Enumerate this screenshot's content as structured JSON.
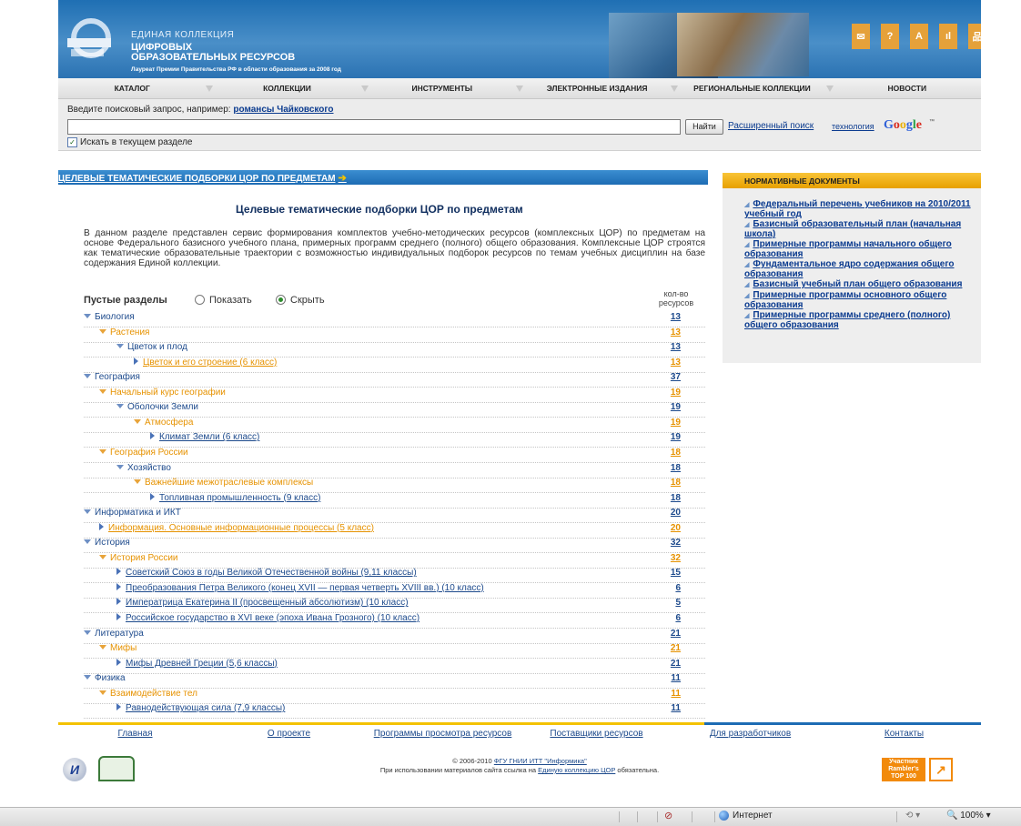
{
  "header": {
    "logo_line1": "ЕДИНАЯ КОЛЛЕКЦИЯ",
    "logo_line2": "ЦИФРОВЫХ",
    "logo_line3": "ОБРАЗОВАТЕЛЬНЫХ РЕСУРСОВ",
    "logo_award": "Лауреат Премии Правительства РФ в области образования за 2008 год",
    "icons": [
      {
        "name": "mail-icon",
        "glyph": "✉"
      },
      {
        "name": "help-icon",
        "glyph": "?"
      },
      {
        "name": "font-size-icon",
        "glyph": "A"
      },
      {
        "name": "stats-icon",
        "glyph": "ıl"
      },
      {
        "name": "sitemap-icon",
        "glyph": "品"
      }
    ]
  },
  "menu": [
    "КАТАЛОГ",
    "КОЛЛЕКЦИИ",
    "ИНСТРУМЕНТЫ",
    "ЭЛЕКТРОННЫЕ ИЗДАНИЯ",
    "РЕГИОНАЛЬНЫЕ КОЛЛЕКЦИИ",
    "НОВОСТИ"
  ],
  "search": {
    "hint": "Введите поисковый запрос, например:",
    "hint_example": "романсы Чайковского",
    "value": "",
    "button": "Найти",
    "advanced": "Расширенный поиск",
    "tech": "технология",
    "google": [
      "G",
      "o",
      "o",
      "g",
      "l",
      "e"
    ],
    "tm": "™",
    "checkbox_label": "Искать в текущем разделе",
    "checkbox_checked": true
  },
  "section_bar": "ЦЕЛЕВЫЕ ТЕМАТИЧЕСКИЕ ПОДБОРКИ ЦОР ПО ПРЕДМЕТАМ",
  "main": {
    "title": "Целевые тематические подборки ЦОР по предметам",
    "intro": "В данном разделе представлен сервис формирования комплектов учебно-методических ресурсов (комплексных ЦОР) по предметам на основе Федерального базисного учебного плана, примерных программ среднего (полного) общего образования. Комплексные ЦОР строятся как тематические образовательные траектории с возможностью индивидуальных подборок ресурсов по темам учебных дисциплин на базе содержания Единой коллекции.",
    "empty_sections_label": "Пустые разделы",
    "show_label": "Показать",
    "hide_label": "Скрыть",
    "selected": "hide",
    "count_header": "кол-во ресурсов",
    "tree": [
      {
        "level": 0,
        "label": "Биология",
        "count": "13",
        "color": "blue",
        "kind": "down"
      },
      {
        "level": 1,
        "label": "Растения",
        "count": "13",
        "color": "orange",
        "kind": "down"
      },
      {
        "level": 2,
        "label": "Цветок и плод",
        "count": "13",
        "color": "blue",
        "kind": "down"
      },
      {
        "level": 3,
        "label": "Цветок и его строение (6 класс)",
        "count": "13",
        "color": "orange",
        "kind": "leaf"
      },
      {
        "level": 0,
        "label": "География",
        "count": "37",
        "color": "blue",
        "kind": "down"
      },
      {
        "level": 1,
        "label": "Начальный курс географии",
        "count": "19",
        "color": "orange",
        "kind": "down"
      },
      {
        "level": 2,
        "label": "Оболочки Земли",
        "count": "19",
        "color": "blue",
        "kind": "down"
      },
      {
        "level": 3,
        "label": "Атмосфера",
        "count": "19",
        "color": "orange",
        "kind": "down"
      },
      {
        "level": 4,
        "label": "Климат Земли (6 класс)",
        "count": "19",
        "color": "blue",
        "kind": "leaf"
      },
      {
        "level": 1,
        "label": "География России",
        "count": "18",
        "color": "orange",
        "kind": "down"
      },
      {
        "level": 2,
        "label": "Хозяйство",
        "count": "18",
        "color": "blue",
        "kind": "down"
      },
      {
        "level": 3,
        "label": "Важнейшие межотраслевые комплексы",
        "count": "18",
        "color": "orange",
        "kind": "down"
      },
      {
        "level": 4,
        "label": "Топливная промышленность (9 класс)",
        "count": "18",
        "color": "blue",
        "kind": "leaf"
      },
      {
        "level": 0,
        "label": "Информатика и ИКТ",
        "count": "20",
        "color": "blue",
        "kind": "down"
      },
      {
        "level": 1,
        "label": "Информация. Основные информационные процессы (5 класс)",
        "count": "20",
        "color": "orange",
        "kind": "leaf"
      },
      {
        "level": 0,
        "label": "История",
        "count": "32",
        "color": "blue",
        "kind": "down"
      },
      {
        "level": 1,
        "label": "История России",
        "count": "32",
        "color": "orange",
        "kind": "down"
      },
      {
        "level": 2,
        "label": "Советский Союз в годы Великой Отечественной войны (9,11 классы)",
        "count": "15",
        "color": "blue",
        "kind": "leaf"
      },
      {
        "level": 2,
        "label": "Преобразования Петра Великого (конец XVII — первая четверть XVIII вв.) (10 класс)",
        "count": "6",
        "color": "blue",
        "kind": "leaf"
      },
      {
        "level": 2,
        "label": "Императрица Екатерина II (просвещенный абсолютизм) (10 класс)",
        "count": "5",
        "color": "blue",
        "kind": "leaf"
      },
      {
        "level": 2,
        "label": "Российское государство в XVI веке (эпоха Ивана Грозного) (10 класс)",
        "count": "6",
        "color": "blue",
        "kind": "leaf"
      },
      {
        "level": 0,
        "label": "Литература",
        "count": "21",
        "color": "blue",
        "kind": "down"
      },
      {
        "level": 1,
        "label": "Мифы",
        "count": "21",
        "color": "orange",
        "kind": "down"
      },
      {
        "level": 2,
        "label": "Мифы Древней Греции (5,6 классы)",
        "count": "21",
        "color": "blue",
        "kind": "leaf"
      },
      {
        "level": 0,
        "label": "Физика",
        "count": "11",
        "color": "blue",
        "kind": "down"
      },
      {
        "level": 1,
        "label": "Взаимодействие тел",
        "count": "11",
        "color": "orange",
        "kind": "down"
      },
      {
        "level": 2,
        "label": "Равнодействующая сила (7,9 классы)",
        "count": "11",
        "color": "blue",
        "kind": "leaf"
      }
    ]
  },
  "norm_docs": {
    "title": "НОРМАТИВНЫЕ ДОКУМЕНТЫ",
    "items": [
      "Федеральный перечень учебников на 2010/2011 учебный год",
      "Базисный образовательный план (начальная школа)",
      "Примерные программы начального общего образования",
      "Фундаментальное ядро содержания общего образования",
      "Базисный учебный план общего образования",
      "Примерные программы основного общего образования",
      "Примерные программы среднего (полного) общего образования"
    ]
  },
  "footer": {
    "nav": [
      "Главная",
      "О проекте",
      "Программы просмотра ресурсов",
      "Поставщики ресурсов",
      "Для разработчиков",
      "Контакты"
    ],
    "copy_prefix": "© 2006-2010",
    "copy_org": "ФГУ ГНИИ ИТТ \"Информика\"",
    "copy_line2_prefix": "При использовании материалов сайта ссылка на",
    "copy_line2_link": "Единую коллекцию ЦОР",
    "copy_line2_suffix": "обязательна.",
    "rambler_line1": "Участник",
    "rambler_line2": "Rambler's",
    "rambler_line3": "TOP 100"
  },
  "statusbar": {
    "zone": "Интернет",
    "zoom": "100%"
  }
}
